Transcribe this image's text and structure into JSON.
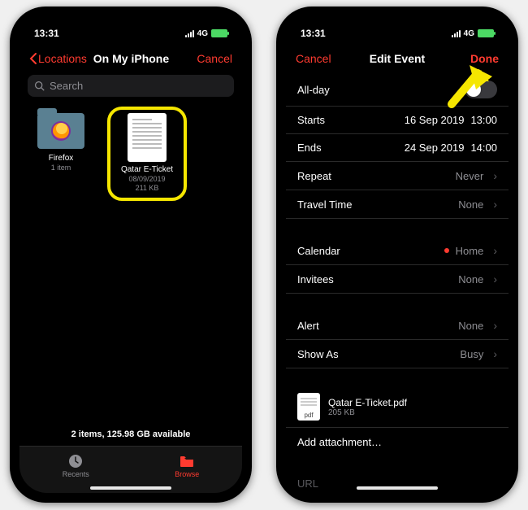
{
  "left": {
    "status": {
      "time": "13:31",
      "network": "4G"
    },
    "nav": {
      "back": "Locations",
      "title": "On My iPhone",
      "cancel": "Cancel"
    },
    "search_placeholder": "Search",
    "items": [
      {
        "name": "Firefox",
        "meta": "1 item"
      },
      {
        "name": "Qatar E-Ticket",
        "date": "08/09/2019",
        "size": "211 KB"
      }
    ],
    "footer": "2 items, 125.98 GB available",
    "tabs": {
      "recents": "Recents",
      "browse": "Browse"
    }
  },
  "right": {
    "status": {
      "time": "13:31",
      "network": "4G"
    },
    "nav": {
      "cancel": "Cancel",
      "title": "Edit Event",
      "done": "Done"
    },
    "rows": {
      "allday": "All-day",
      "starts": {
        "label": "Starts",
        "date": "16 Sep 2019",
        "time": "13:00"
      },
      "ends": {
        "label": "Ends",
        "date": "24 Sep 2019",
        "time": "14:00"
      },
      "repeat": {
        "label": "Repeat",
        "value": "Never"
      },
      "travel": {
        "label": "Travel Time",
        "value": "None"
      },
      "calendar": {
        "label": "Calendar",
        "value": "Home"
      },
      "invitees": {
        "label": "Invitees",
        "value": "None"
      },
      "alert": {
        "label": "Alert",
        "value": "None"
      },
      "showas": {
        "label": "Show As",
        "value": "Busy"
      }
    },
    "attachment": {
      "icon_label": "pdf",
      "name": "Qatar E-Ticket.pdf",
      "size": "205 KB"
    },
    "add_attachment": "Add attachment…",
    "url_label": "URL"
  }
}
